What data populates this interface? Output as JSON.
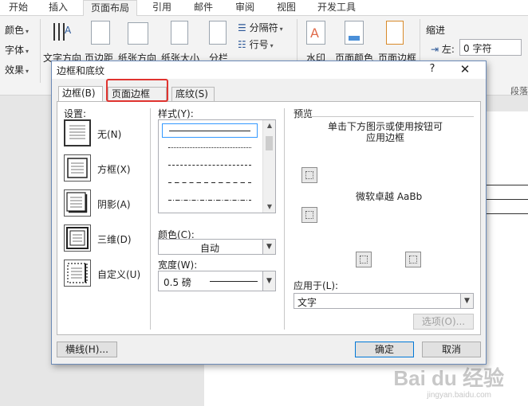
{
  "ribbon": {
    "tabs": [
      "开始",
      "插入",
      "页面布局",
      "引用",
      "邮件",
      "审阅",
      "视图",
      "开发工具"
    ],
    "active_tab": "页面布局",
    "theme_group": [
      "颜色",
      "字体",
      "效果"
    ],
    "page_setup": [
      "文字方向",
      "页边距",
      "纸张方向",
      "纸张大小",
      "分栏"
    ],
    "breaks": [
      "分隔符",
      "行号"
    ],
    "page_background": [
      "水印",
      "页面颜色",
      "页面边框"
    ],
    "indent": {
      "title": "缩进",
      "left_label": "左:",
      "left_value": "0 字符"
    },
    "paragraph_group": "段落"
  },
  "watermark": {
    "text": "Bai du 经验",
    "sub": "jingyan.baidu.com"
  },
  "dialog": {
    "title": "边框和底纹",
    "help": "?",
    "close": "✕",
    "tabs": [
      "边框(B)",
      "页面边框(P)",
      "底纹(S)"
    ],
    "active_tab": "边框(B)",
    "highlighted_tab": "页面边框(P)",
    "settings_label": "设置:",
    "settings": [
      "无(N)",
      "方框(X)",
      "阴影(A)",
      "三维(D)",
      "自定义(U)"
    ],
    "style_label": "样式(Y):",
    "color_label": "颜色(C):",
    "color_value": "自动",
    "width_label": "宽度(W):",
    "width_value": "0.5 磅",
    "preview_label": "预览",
    "preview_hint": "单击下方图示或使用按钮可\n应用边框",
    "preview_sample": "微软卓越 AaBb",
    "apply_label": "应用于(L):",
    "apply_value": "文字",
    "options_button": "选项(O)...",
    "horizontal_line_button": "横线(H)...",
    "ok_button": "确定",
    "cancel_button": "取消"
  }
}
